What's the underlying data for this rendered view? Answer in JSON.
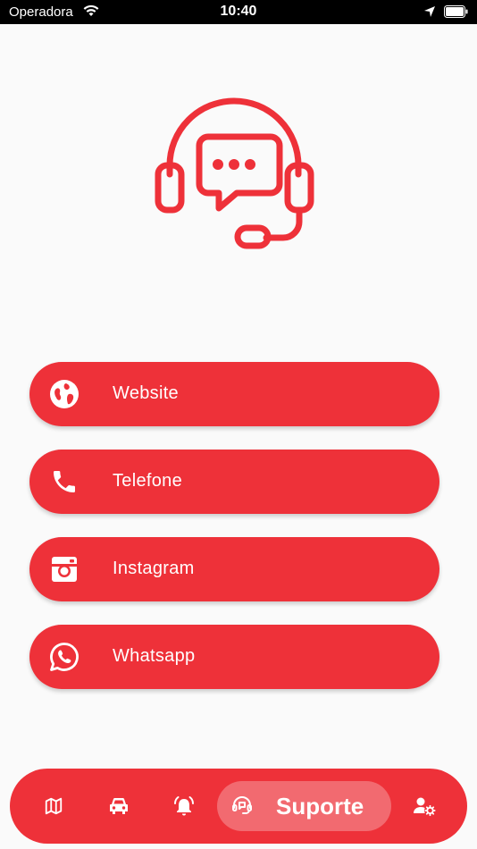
{
  "status_bar": {
    "carrier": "Operadora",
    "time": "10:40"
  },
  "actions": [
    {
      "label": "Website",
      "icon": "globe-icon"
    },
    {
      "label": "Telefone",
      "icon": "phone-icon"
    },
    {
      "label": "Instagram",
      "icon": "instagram-icon"
    },
    {
      "label": "Whatsapp",
      "icon": "whatsapp-icon"
    }
  ],
  "bottom_nav": {
    "items": [
      {
        "icon": "map-icon"
      },
      {
        "icon": "car-icon"
      },
      {
        "icon": "alarm-icon"
      },
      {
        "icon": "support-icon",
        "label": "Suporte",
        "active": true
      },
      {
        "icon": "user-settings-icon"
      }
    ]
  },
  "colors": {
    "accent": "#ee3139",
    "background": "#fafafa"
  }
}
